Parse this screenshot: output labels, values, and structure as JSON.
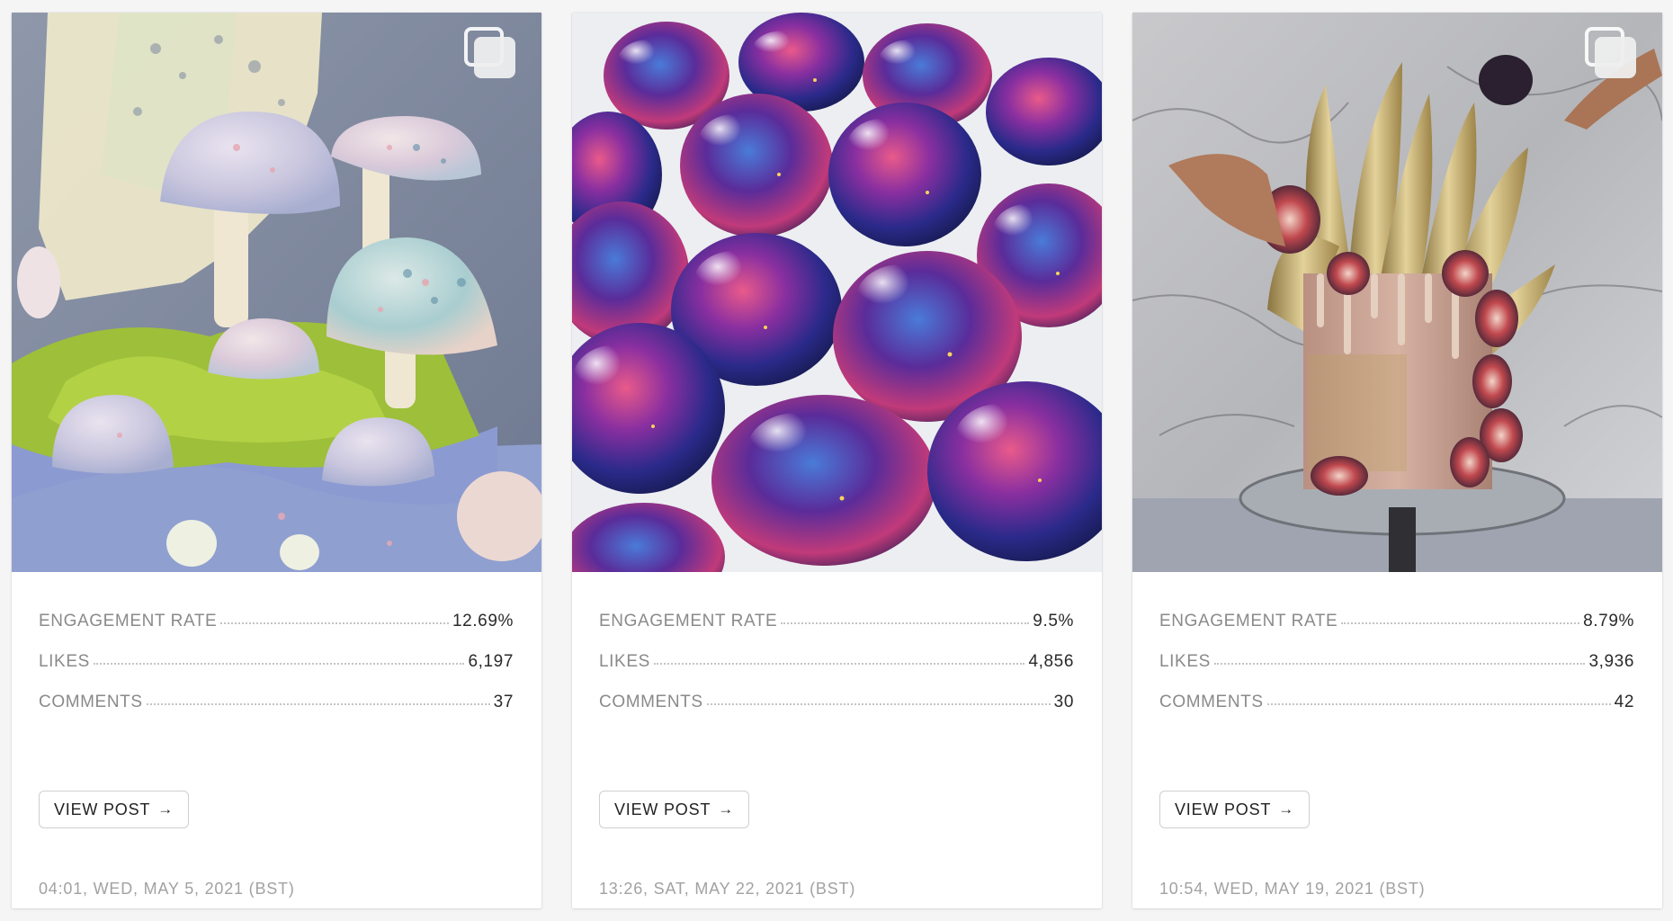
{
  "posts": [
    {
      "image": "mushroom-cake-photo",
      "is_carousel": true,
      "stats": {
        "engagement_label": "ENGAGEMENT RATE",
        "engagement_value": "12.69%",
        "likes_label": "LIKES",
        "likes_value": "6,197",
        "comments_label": "COMMENTS",
        "comments_value": "37"
      },
      "button_label": "VIEW POST",
      "button_icon": "arrow-right-icon",
      "timestamp": "04:01, WED, MAY 5, 2021 (BST)"
    },
    {
      "image": "galaxy-bonbons-photo",
      "is_carousel": false,
      "stats": {
        "engagement_label": "ENGAGEMENT RATE",
        "engagement_value": "9.5%",
        "likes_label": "LIKES",
        "likes_value": "4,856",
        "comments_label": "COMMENTS",
        "comments_value": "30"
      },
      "button_label": "VIEW POST",
      "button_icon": "arrow-right-icon",
      "timestamp": "13:26, SAT, MAY 22, 2021 (BST)"
    },
    {
      "image": "fig-drip-cake-photo",
      "is_carousel": true,
      "stats": {
        "engagement_label": "ENGAGEMENT RATE",
        "engagement_value": "8.79%",
        "likes_label": "LIKES",
        "likes_value": "3,936",
        "comments_label": "COMMENTS",
        "comments_value": "42"
      },
      "button_label": "VIEW POST",
      "button_icon": "arrow-right-icon",
      "timestamp": "10:54, WED, MAY 19, 2021 (BST)"
    }
  ],
  "colors": {
    "page_background": "#f5f5f6",
    "card_background": "#ffffff",
    "label_text": "#8a8a8a",
    "value_text": "#2a2a2a",
    "timestamp_text": "#a2a2a2",
    "button_border": "#cfcfcf"
  }
}
